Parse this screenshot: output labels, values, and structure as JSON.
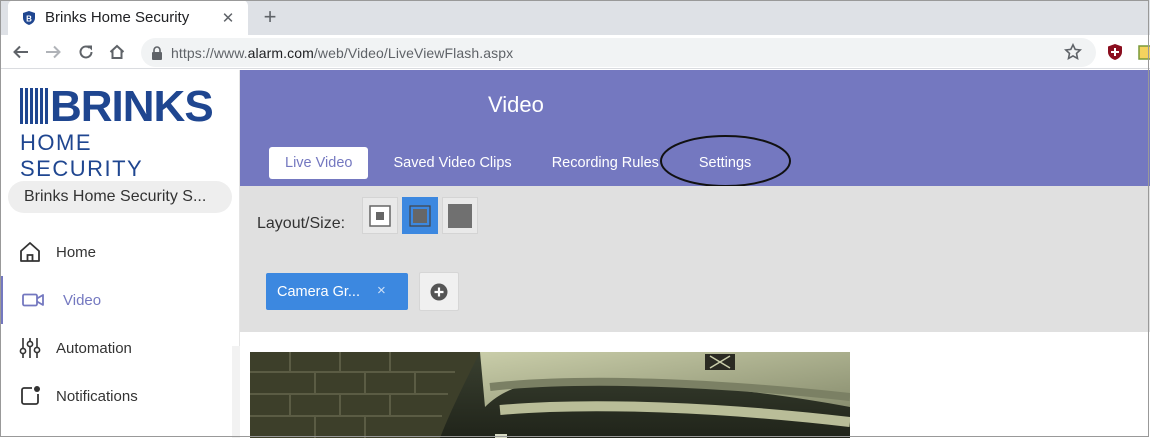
{
  "browser": {
    "tab_title": "Brinks Home Security",
    "url_prefix": "https://www.",
    "url_domain": "alarm.com",
    "url_path": "/web/Video/LiveViewFlash.aspx"
  },
  "sidebar": {
    "logo_main": "BRINKS",
    "logo_sub": "HOME SECURITY",
    "account": "Brinks Home Security S...",
    "items": [
      {
        "label": "Home",
        "icon": "home-icon"
      },
      {
        "label": "Video",
        "icon": "video-camera-icon",
        "active": true
      },
      {
        "label": "Automation",
        "icon": "sliders-icon"
      },
      {
        "label": "Notifications",
        "icon": "notifications-icon"
      }
    ]
  },
  "header": {
    "title": "Video",
    "tabs": [
      {
        "label": "Live Video",
        "active": true
      },
      {
        "label": "Saved Video Clips"
      },
      {
        "label": "Recording Rules"
      },
      {
        "label": "Settings",
        "highlighted": true
      }
    ]
  },
  "controls": {
    "layout_label": "Layout/Size:",
    "camera_chip": "Camera Gr...",
    "camera_chip_close": "×"
  },
  "colors": {
    "header_bg": "#7478c0",
    "accent_blue": "#3c88e0",
    "brand_navy": "#1f4690"
  }
}
